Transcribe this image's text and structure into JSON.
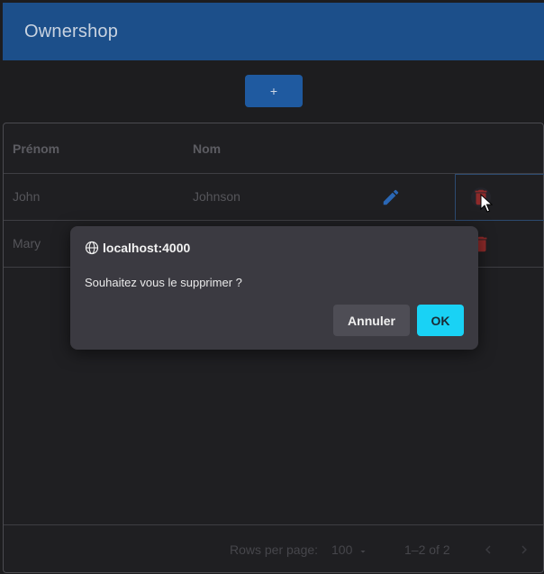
{
  "app": {
    "title": "Ownershop"
  },
  "toolbar": {
    "add_label": "+"
  },
  "table": {
    "columns": [
      "Prénom",
      "Nom"
    ],
    "rows": [
      {
        "prenom": "John",
        "nom": "Johnson"
      },
      {
        "prenom": "Mary",
        "nom": ""
      }
    ]
  },
  "footer": {
    "rows_per_page_label": "Rows per page:",
    "rows_per_page_value": "100",
    "page_info": "1–2 of 2"
  },
  "dialog": {
    "origin": "localhost:4000",
    "message": "Souhaitez vous le supprimer ?",
    "cancel_label": "Annuler",
    "ok_label": "OK"
  },
  "colors": {
    "appbar": "#1c4f8a",
    "primary_button": "#1f5aa0",
    "edit_icon": "#2a67b5",
    "delete_icon": "#9b2a2a",
    "ok_button": "#19d2f5"
  }
}
